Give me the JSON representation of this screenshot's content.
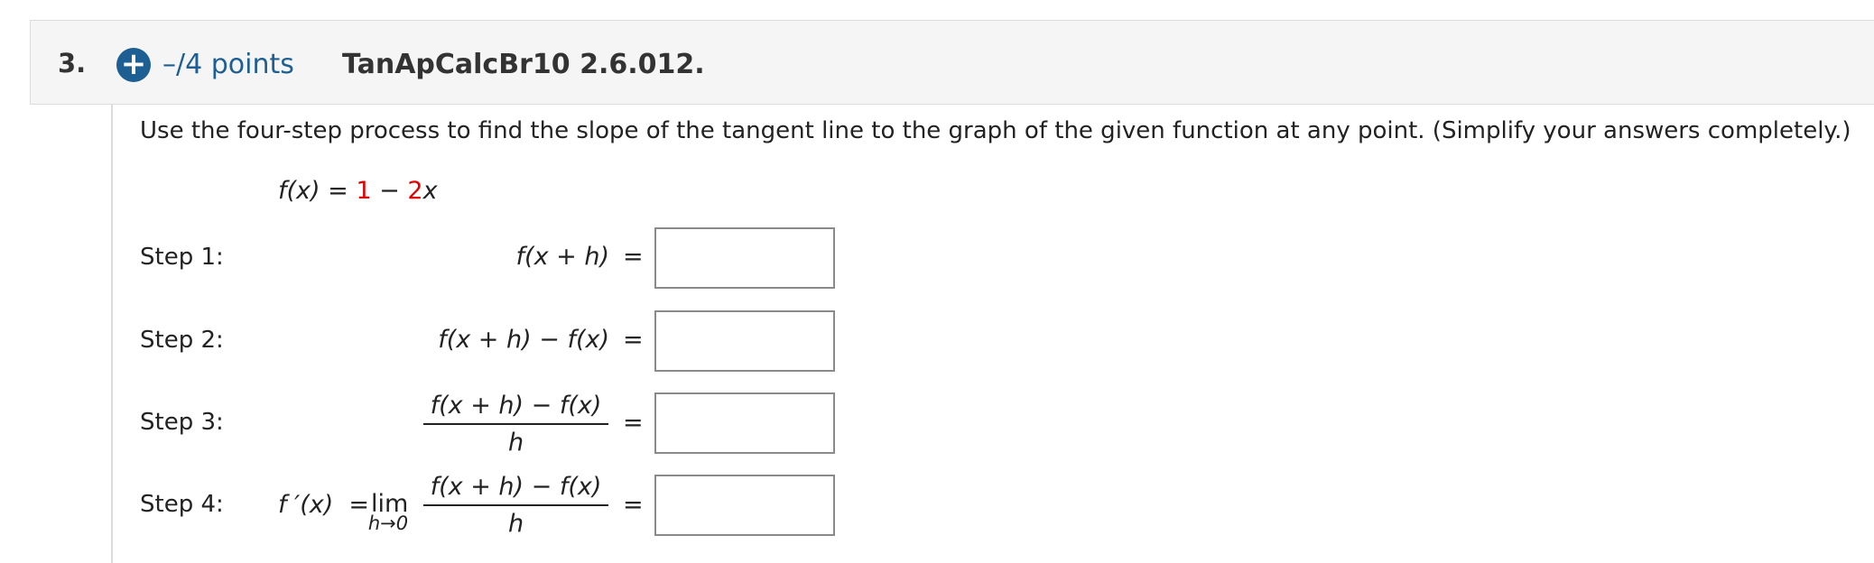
{
  "question": {
    "number": "3.",
    "points": "–/4 points",
    "id": "TanApCalcBr10 2.6.012.",
    "accent_color": "#1e5f93"
  },
  "instruction": "Use the four-step process to find the slope of the tangent line to the graph of the given function at any point. (Simplify your answers completely.)",
  "function": {
    "lhs": "f(x)",
    "equals": "=",
    "const": "1",
    "minus": "−",
    "coef": "2",
    "var": "x",
    "highlight_color": "#e00000"
  },
  "steps": [
    {
      "label": "Step 1:",
      "expr": "f(x + h)",
      "eq": "=",
      "answer": ""
    },
    {
      "label": "Step 2:",
      "expr": "f(x + h) − f(x)",
      "eq": "=",
      "answer": ""
    },
    {
      "label": "Step 3:",
      "numerator": "f(x + h) − f(x)",
      "denominator": "h",
      "eq": "=",
      "answer": ""
    },
    {
      "label": "Step 4:",
      "prefix": "f ′(x)  =",
      "lim": "lim",
      "lim_sub": "h→0",
      "numerator": "f(x + h) − f(x)",
      "denominator": "h",
      "eq": "=",
      "answer": ""
    }
  ]
}
